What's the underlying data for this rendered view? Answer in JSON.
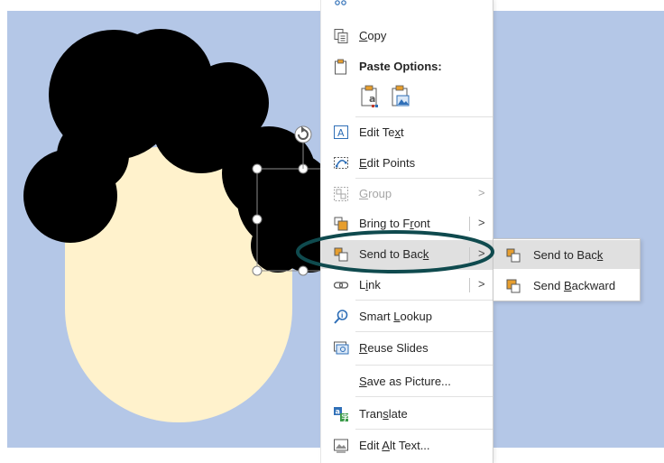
{
  "colors": {
    "slide_bg": "#b4c7e7",
    "hair": "#000000",
    "face": "#fff2cc",
    "menu_hover": "#e0e0e0",
    "icon_orange": "#e69e2e",
    "icon_blue": "#2f6fb7",
    "annotation": "#0f4a4e"
  },
  "context_menu": {
    "top_partial_label": "",
    "copy": {
      "pre": "",
      "u": "C",
      "post": "opy",
      "icon": "copy-icon"
    },
    "paste_options": {
      "label": "Paste Options:",
      "icon": "paste-icon"
    },
    "paste_buttons": [
      "paste-keep-text-icon",
      "paste-picture-icon"
    ],
    "edit_text": {
      "pre": "Edit Te",
      "u": "x",
      "post": "t",
      "icon": "edit-text-icon"
    },
    "edit_points": {
      "pre": "",
      "u": "E",
      "post": "dit Points",
      "icon": "edit-points-icon"
    },
    "group": {
      "pre": "",
      "u": "G",
      "post": "roup",
      "icon": "group-icon",
      "disabled": true
    },
    "bring_to_front": {
      "pre": "Bring to F",
      "u": "r",
      "post": "ont",
      "icon": "bring-to-front-icon"
    },
    "send_to_back": {
      "pre": "Send to Bac",
      "u": "k",
      "post": "",
      "icon": "send-to-back-icon",
      "highlighted": true
    },
    "link": {
      "pre": "L",
      "u": "i",
      "post": "nk",
      "icon": "link-icon"
    },
    "smart_lookup": {
      "pre": "Smart ",
      "u": "L",
      "post": "ookup",
      "icon": "smart-lookup-icon"
    },
    "reuse_slides": {
      "pre": "",
      "u": "R",
      "post": "euse Slides",
      "icon": "reuse-slides-icon"
    },
    "save_as_picture": {
      "pre": "",
      "u": "S",
      "post": "ave as Picture...",
      "icon": ""
    },
    "translate": {
      "pre": "Tran",
      "u": "s",
      "post": "late",
      "icon": "translate-icon"
    },
    "edit_alt_text": {
      "pre": "Edit ",
      "u": "A",
      "post": "lt Text...",
      "icon": "alt-text-icon"
    },
    "arrow": ">"
  },
  "submenu": {
    "send_to_back": {
      "pre": "Send to Bac",
      "u": "k",
      "post": "",
      "icon": "send-to-back-icon",
      "highlighted": true
    },
    "send_backward": {
      "pre": "Send ",
      "u": "B",
      "post": "ackward",
      "icon": "send-backward-icon"
    }
  }
}
